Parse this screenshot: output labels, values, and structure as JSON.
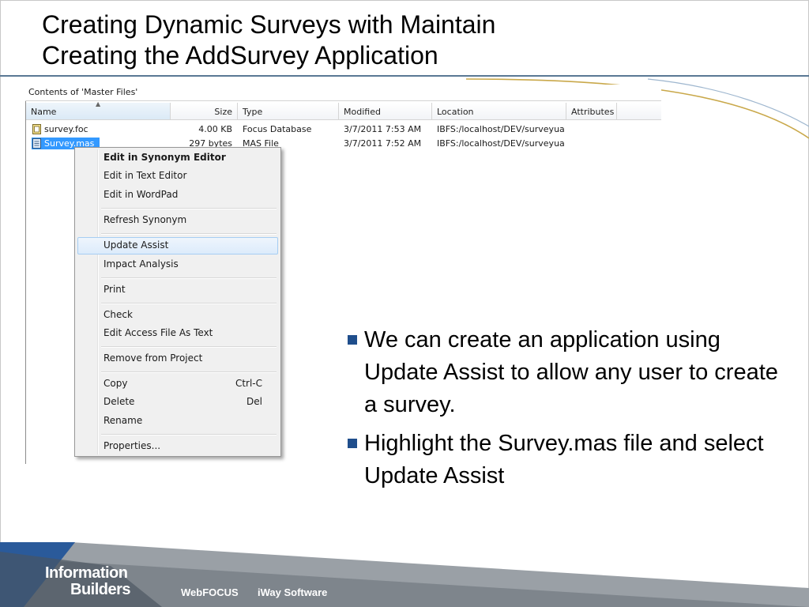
{
  "slide": {
    "title_line1": "Creating Dynamic Surveys with Maintain",
    "title_line2": "Creating the AddSurvey Application"
  },
  "explorer": {
    "caption": "Contents of 'Master Files'",
    "columns": [
      "Name",
      "Size",
      "Type",
      "Modified",
      "Location",
      "Attributes"
    ],
    "rows": [
      {
        "name": "survey.foc",
        "size": "4.00 KB",
        "type": "Focus Database",
        "modified": "3/7/2011 7:53 AM",
        "location": "IBFS:/localhost/DEV/surveyua",
        "icon": "focus-database-icon"
      },
      {
        "name": "Survey.mas",
        "size": "297 bytes",
        "type": "MAS File",
        "modified": "3/7/2011 7:52 AM",
        "location": "IBFS:/localhost/DEV/surveyua",
        "icon": "master-file-icon"
      }
    ]
  },
  "context_menu": {
    "items": [
      {
        "label": "Edit in Synonym Editor"
      },
      {
        "label": "Edit in Text Editor"
      },
      {
        "label": "Edit in WordPad"
      },
      {
        "label": "Refresh Synonym"
      },
      {
        "label": "Update Assist"
      },
      {
        "label": "Impact Analysis"
      },
      {
        "label": "Print"
      },
      {
        "label": "Check"
      },
      {
        "label": "Edit Access File As Text"
      },
      {
        "label": "Remove from Project"
      },
      {
        "label": "Copy",
        "shortcut": "Ctrl-C"
      },
      {
        "label": "Delete",
        "shortcut": "Del"
      },
      {
        "label": "Rename"
      },
      {
        "label": "Properties..."
      }
    ]
  },
  "bullets": [
    "We can create an application using Update Assist to allow any user to create a survey.",
    "Highlight the Survey.mas file and select Update Assist"
  ],
  "footer": {
    "logo_line1": "Information",
    "logo_line2": "Builders",
    "product1": "WebFOCUS",
    "product2": "iWay Software"
  },
  "colors": {
    "accent": "#1f4e8c",
    "selection": "#3399ff",
    "curve": "#c9a84a",
    "footer_blue": "#2a5a9a"
  }
}
